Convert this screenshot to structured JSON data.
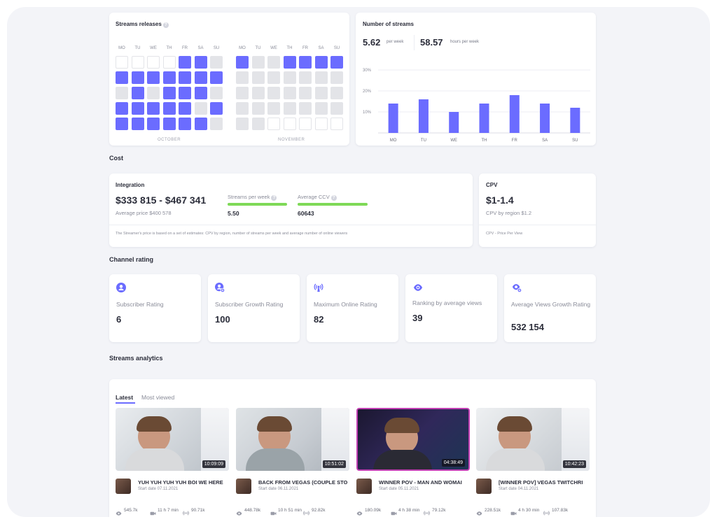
{
  "colors": {
    "accent": "#6b6cff",
    "green": "#7ed957",
    "cell_off": "#e3e4e8"
  },
  "releases": {
    "title": "Streams releases",
    "days": [
      "MO",
      "TU",
      "WE",
      "TH",
      "FR",
      "SA",
      "SU"
    ],
    "months": [
      {
        "label": "OCTOBER",
        "rows": [
          [
            "empty",
            "empty",
            "empty",
            "empty",
            "on",
            "on",
            "off"
          ],
          [
            "on",
            "on",
            "on",
            "on",
            "on",
            "on",
            "on"
          ],
          [
            "off",
            "on",
            "off",
            "on",
            "on",
            "on",
            "off"
          ],
          [
            "on",
            "on",
            "on",
            "on",
            "on",
            "off",
            "on"
          ],
          [
            "on",
            "on",
            "on",
            "on",
            "on",
            "on",
            "off"
          ]
        ]
      },
      {
        "label": "NOVEMBER",
        "rows": [
          [
            "on",
            "off",
            "off",
            "on",
            "on",
            "on",
            "on"
          ],
          [
            "off",
            "off",
            "off",
            "off",
            "off",
            "off",
            "off"
          ],
          [
            "off",
            "off",
            "off",
            "off",
            "off",
            "off",
            "off"
          ],
          [
            "off",
            "off",
            "off",
            "off",
            "off",
            "off",
            "off"
          ],
          [
            "off",
            "off",
            "empty",
            "empty",
            "empty",
            "empty",
            "empty"
          ]
        ]
      }
    ]
  },
  "streams_count": {
    "title": "Number of streams",
    "per_week_value": "5.62",
    "per_week_unit": "per week",
    "hours_value": "58.57",
    "hours_unit": "hours per week"
  },
  "chart_data": {
    "type": "bar",
    "categories": [
      "MO",
      "TU",
      "WE",
      "TH",
      "FR",
      "SA",
      "SU"
    ],
    "values": [
      14,
      16,
      10,
      14,
      18,
      14,
      12
    ],
    "yticks": [
      "30%",
      "20%",
      "10%"
    ],
    "ylim": [
      0,
      30
    ],
    "grid": true
  },
  "cost": {
    "section": "Cost",
    "integration": {
      "title": "Integration",
      "range": "$333 815 - $467 341",
      "avg_price": "Average price $400 578",
      "streams_label": "Streams per week",
      "streams_value": "5.50",
      "ccv_label": "Average CCV",
      "ccv_value": "60643",
      "note": "The Streamer's price is based on a set of estimates: CPV by region, number of streams per week and average number of online viewers"
    },
    "cpv": {
      "title": "CPV",
      "value": "$1-1.4",
      "region": "CPV by region $1.2",
      "note": "CPV - Price Per View"
    }
  },
  "rating": {
    "section": "Channel rating",
    "cards": [
      {
        "icon": "user-icon",
        "label": "Subscriber Rating",
        "value": "6"
      },
      {
        "icon": "user-plus-icon",
        "label": "Subscriber Growth Rating",
        "value": "100"
      },
      {
        "icon": "broadcast-icon",
        "label": "Maximum Online Rating",
        "value": "82"
      },
      {
        "icon": "eye-icon",
        "label": "Ranking by average views",
        "value": "39"
      },
      {
        "icon": "views-growth-icon",
        "label": "Average Views Growth Rating",
        "value": "532 154"
      }
    ]
  },
  "analytics": {
    "section": "Streams analytics",
    "tabs": [
      "Latest",
      "Most viewed"
    ],
    "videos": [
      {
        "title": "YUH YUH YUH YUH BOI WE HERE",
        "date": "Start date 07.11.2021",
        "duration": "10:09:09",
        "views": "545.7k",
        "length": "11 h 7 min",
        "viewers": "90.71k"
      },
      {
        "title": "BACK FROM VEGAS (COUPLE STO",
        "date": "Start date 06.11.2021",
        "duration": "10:51:02",
        "views": "448.78k",
        "length": "10 h 51 min",
        "viewers": "92.82k"
      },
      {
        "title": "WINNER POV - MAN AND WOMAI",
        "date": "Start date 05.11.2021",
        "duration": "04:38:49",
        "views": "180.09k",
        "length": "4 h 38 min",
        "viewers": "79.12k"
      },
      {
        "title": "[WINNER POV] VEGAS TWITCHRI",
        "date": "Start date 04.11.2021",
        "duration": "10:42:23",
        "views": "228.51k",
        "length": "4 h 30 min",
        "viewers": "107.83k"
      }
    ]
  }
}
